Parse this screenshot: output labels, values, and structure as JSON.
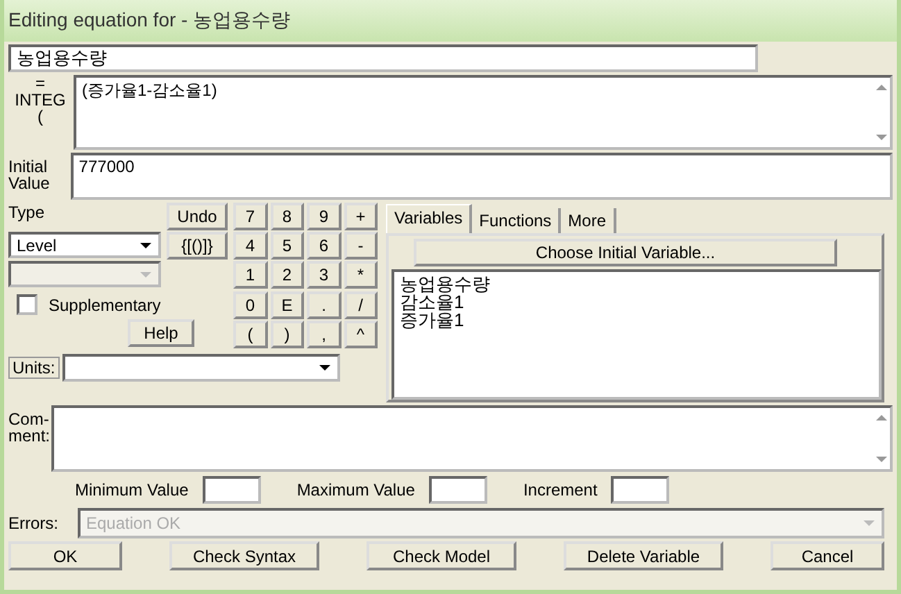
{
  "window": {
    "title": "Editing equation for - 농업용수량"
  },
  "name_field": {
    "value": "농업용수량"
  },
  "equation": {
    "label": "= INTEG (",
    "value": "(증가율1-감소율1)"
  },
  "initial_value": {
    "label": "Initial Value",
    "value": "777000"
  },
  "type": {
    "label": "Type",
    "value": "Level"
  },
  "subtype": {
    "disabled": true
  },
  "supplementary": {
    "label": "Supplementary",
    "checked": false
  },
  "undo_button": "Undo",
  "brackets_button": "{[()]}",
  "help_button": "Help",
  "keypad": [
    "7",
    "8",
    "9",
    "+",
    "4",
    "5",
    "6",
    "-",
    "1",
    "2",
    "3",
    "*",
    "0",
    "E",
    ".",
    "/",
    "(",
    ")",
    ",",
    "^"
  ],
  "units": {
    "label": "Units:"
  },
  "tabs": [
    {
      "label": "Variables",
      "selected": true
    },
    {
      "label": "Functions",
      "selected": false
    },
    {
      "label": "More",
      "selected": false
    }
  ],
  "choose_button": "Choose Initial Variable...",
  "variables": [
    "농업용수량",
    "감소율1",
    "증가율1"
  ],
  "comment": {
    "label": "Com-ment:"
  },
  "ranges": [
    {
      "label": "Minimum Value"
    },
    {
      "label": "Maximum Value"
    },
    {
      "label": "Increment"
    }
  ],
  "errors": {
    "label": "Errors:",
    "value": "Equation OK"
  },
  "buttons": [
    "OK",
    "Check Syntax",
    "Check Model",
    "Delete Variable",
    "Cancel"
  ]
}
